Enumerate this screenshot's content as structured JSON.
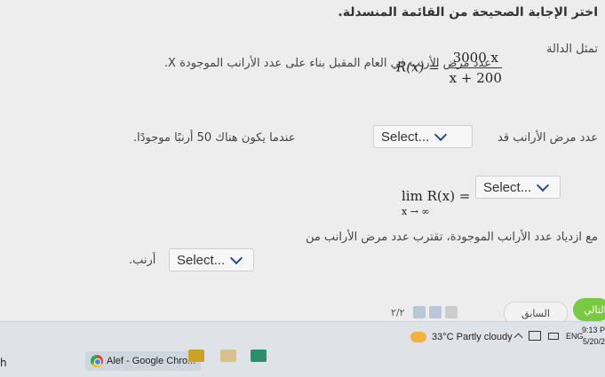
{
  "question": {
    "heading": "اختر الإجابة الصحيحة من القائمة المنسدلة.",
    "eq_label": "تمثل الدالة",
    "formula_lhs": "R(x) =",
    "formula_num": "3000 x",
    "formula_den": "x + 200",
    "eq_desc": "عدد مرض الأرنب في العام المقبل بناء على عدد الأرانب الموجودة X.",
    "q2_text": "عدد مرض الأرانب قد",
    "q2_tail": "عندما يكون هناك 50 أرنبًا موجودًا.",
    "select1": "Select...",
    "lim_main": "lim R(x) =",
    "lim_sub": "x → ∞",
    "select2": "Select...",
    "q3_text": "مع ازدياد عدد الأرانب الموجودة، تقترب عدد مرض الأرانب من",
    "q3_tail": "أرنب.",
    "select3": "Select...",
    "chevron_icon": "chevron-down-icon"
  },
  "footer": {
    "page_count": "٢/٢",
    "prev_label": "السابق",
    "next_label": "التالي"
  },
  "taskbar": {
    "search_fragment": "h",
    "chrome_label": "Alef - Google Chro...",
    "weather": "33°C Partly cloudy",
    "lang": "ENG",
    "time": "9:13 P",
    "date": "5/20/2"
  },
  "colors": {
    "accent_green": "#7ac943",
    "chevron_blue": "#2a4b8c"
  }
}
